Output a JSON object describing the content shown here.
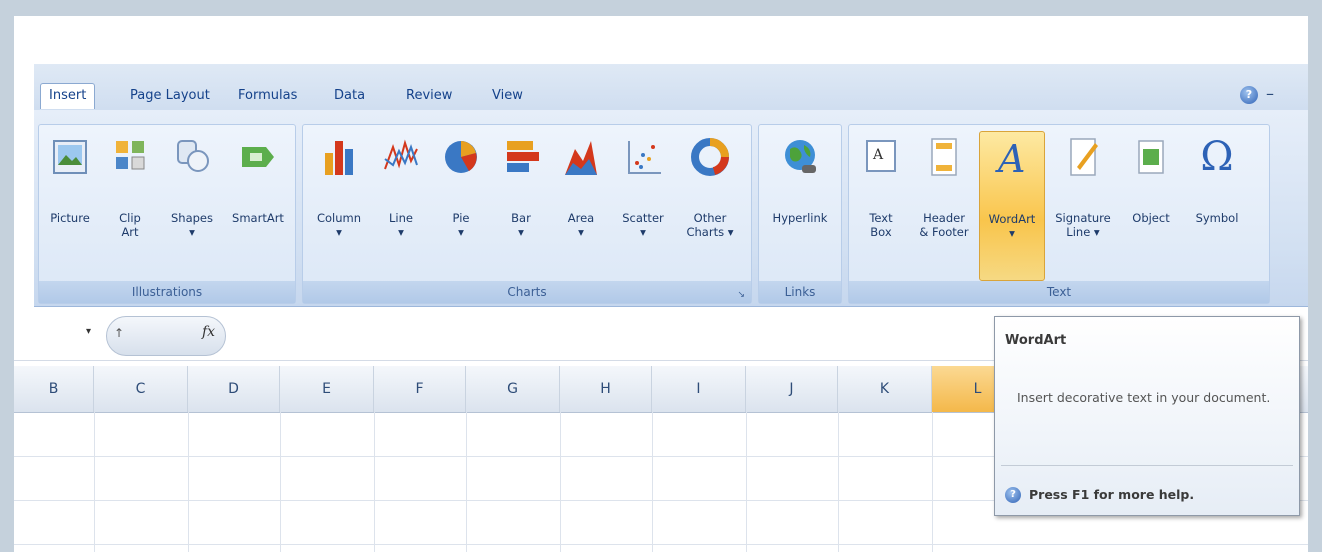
{
  "tabs": [
    "Insert",
    "Page Layout",
    "Formulas",
    "Data",
    "Review",
    "View"
  ],
  "groups": {
    "illustrations": {
      "label": "Illustrations",
      "buttons": [
        "Picture",
        "Clip\nArt",
        "Shapes\n▾",
        "SmartArt"
      ]
    },
    "charts": {
      "label": "Charts",
      "buttons": [
        "Column\n▾",
        "Line\n▾",
        "Pie\n▾",
        "Bar\n▾",
        "Area\n▾",
        "Scatter\n▾",
        "Other\nCharts ▾"
      ],
      "launcher": "↘"
    },
    "links": {
      "label": "Links",
      "buttons": [
        "Hyperlink"
      ]
    },
    "text": {
      "label": "Text",
      "buttons": [
        "Text\nBox",
        "Header\n& Footer",
        "WordArt\n▾",
        "Signature\nLine ▾",
        "Object",
        "Symbol"
      ]
    }
  },
  "formula_bar": {
    "fx": "fx",
    "namebox_arrow": "▾",
    "value": "↑"
  },
  "columns": [
    "B",
    "C",
    "D",
    "E",
    "F",
    "G",
    "H",
    "I",
    "J",
    "K",
    "L"
  ],
  "selected_column": "L",
  "tooltip": {
    "title": "WordArt",
    "description": "Insert decorative text in your document.",
    "help": "Press F1 for more help."
  },
  "icons": {
    "help": "?",
    "minimize": "–",
    "symbol": "Ω",
    "wordart": "A"
  },
  "colors": {
    "accent": "#15428b",
    "highlight": "#f9c54c"
  }
}
